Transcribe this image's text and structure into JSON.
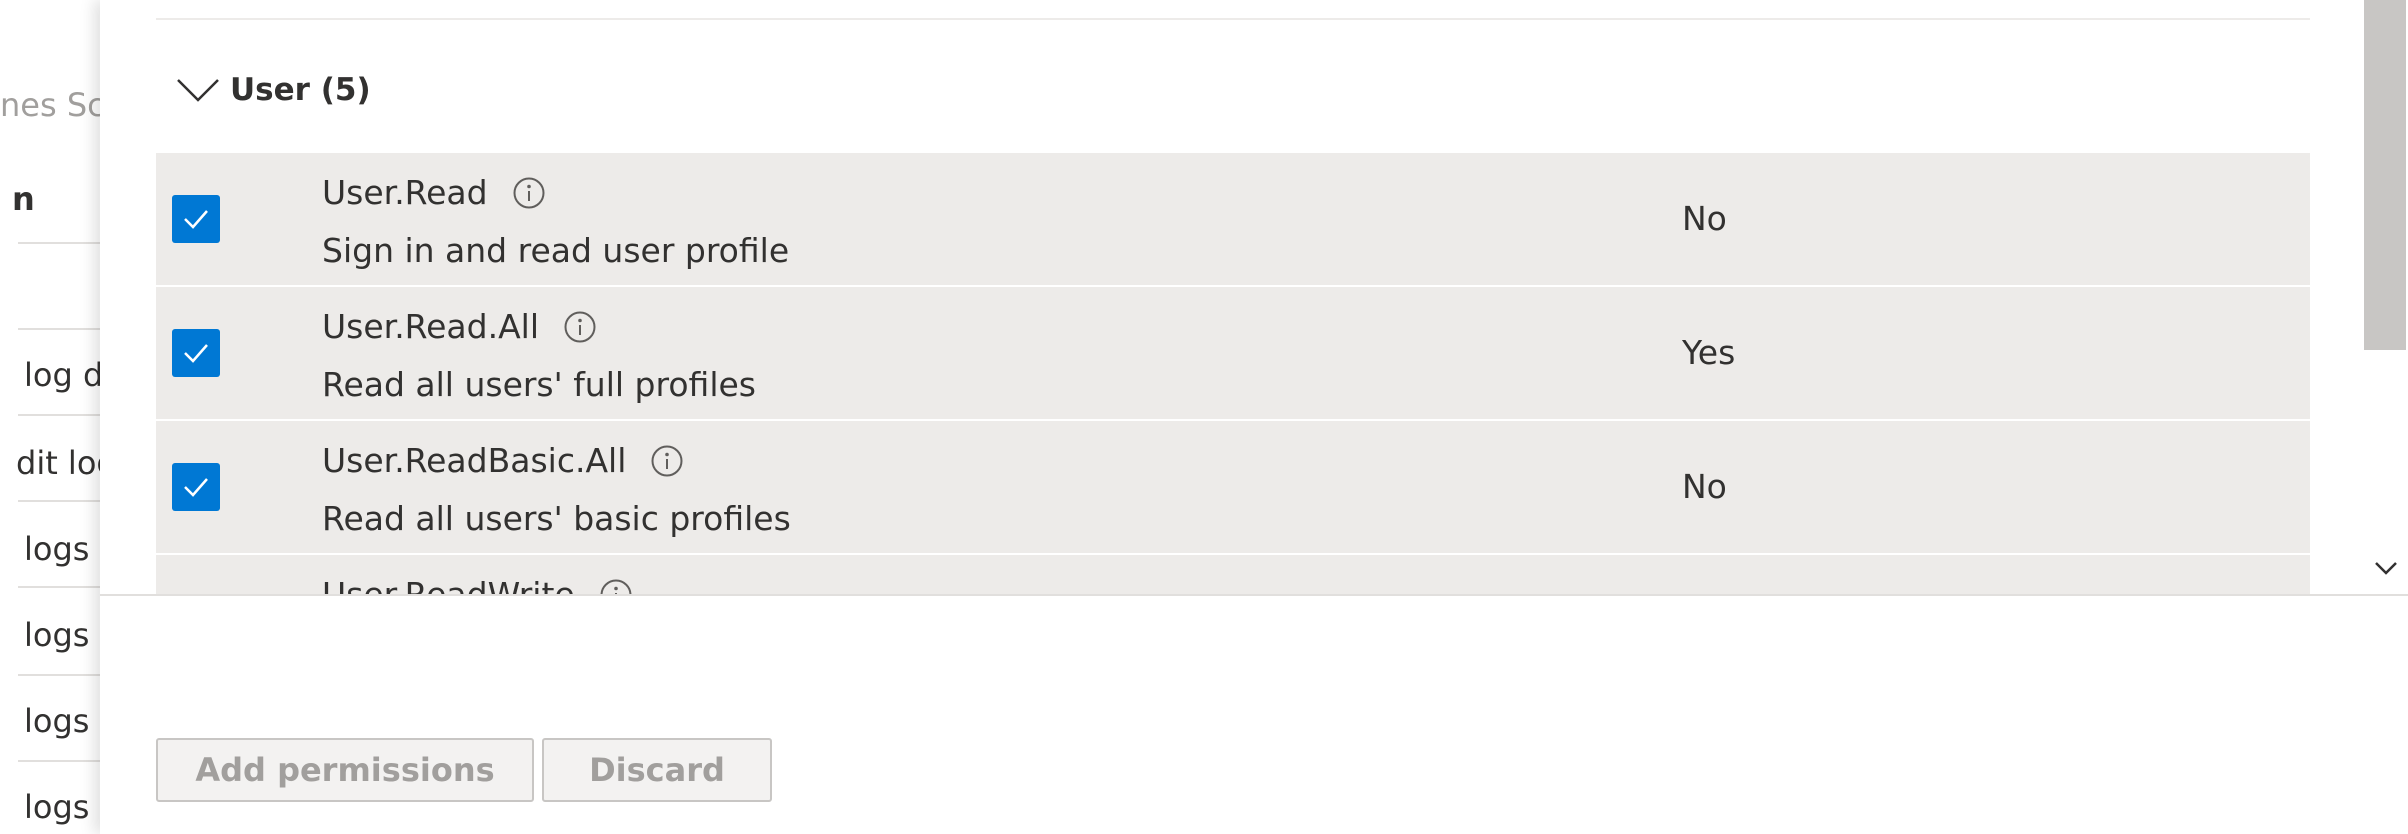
{
  "background": {
    "fragments": [
      "nes Sc",
      "n",
      "log d",
      "dit log",
      "logs c",
      "logs c",
      "logs c",
      "logs c"
    ]
  },
  "group": {
    "title": "User (5)"
  },
  "permissions": [
    {
      "name": "User.Read",
      "description": "Sign in and read user profile",
      "admin_consent": "No",
      "checked": true
    },
    {
      "name": "User.Read.All",
      "description": "Read all users' full profiles",
      "admin_consent": "Yes",
      "checked": true
    },
    {
      "name": "User.ReadBasic.All",
      "description": "Read all users' basic profiles",
      "admin_consent": "No",
      "checked": true
    },
    {
      "name": "User.ReadWrite",
      "description": "",
      "admin_consent": "",
      "checked": false
    }
  ],
  "actions": {
    "add_label": "Add permissions",
    "discard_label": "Discard"
  },
  "colors": {
    "accent": "#0078d4",
    "row_bg": "#edebe9",
    "button_disabled_text": "#a19f9d"
  },
  "icons": {
    "group_toggle": "chevron-down-icon",
    "info": "info-icon",
    "check": "checkmark-icon"
  }
}
